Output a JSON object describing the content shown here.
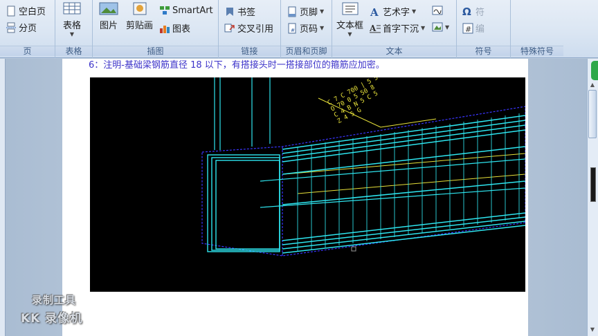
{
  "ribbon": {
    "groups": {
      "page": {
        "label": "页",
        "blank_page": "空白页",
        "page_break": "分页"
      },
      "table": {
        "label": "表格",
        "table": "表格"
      },
      "illustrations": {
        "label": "插图",
        "picture": "图片",
        "clipart": "剪贴画",
        "smartart": "SmartArt",
        "chart": "图表"
      },
      "links": {
        "label": "链接",
        "bookmark": "书签",
        "cross_reference": "交叉引用"
      },
      "header_footer": {
        "label": "页眉和页脚",
        "footer": "页脚",
        "page_number": "页码"
      },
      "text": {
        "label": "文本",
        "textbox": "文本框",
        "wordart": "艺术字",
        "dropcap": "首字下沉"
      },
      "symbols": {
        "label": "符号",
        "equation": "符",
        "symbol": "编"
      },
      "special_symbols": {
        "label": "特殊符号"
      }
    }
  },
  "document": {
    "note_line": "6：注明-基础梁钢筋直径 18 以下，有搭接头时一搭接部位的箍筋应加密。"
  },
  "watermark": {
    "line1": "录制工具",
    "line2": "KK 录像机"
  },
  "colors": {
    "ribbon_bg": "#dbe6f3",
    "group_label": "#3d5c85",
    "doc_text": "#3b32c9",
    "cad_bg": "#000000",
    "rebar_cyan": "#2ee6f0",
    "dim_yellow": "#e8e23a",
    "outline_blue": "#3a35ff"
  }
}
